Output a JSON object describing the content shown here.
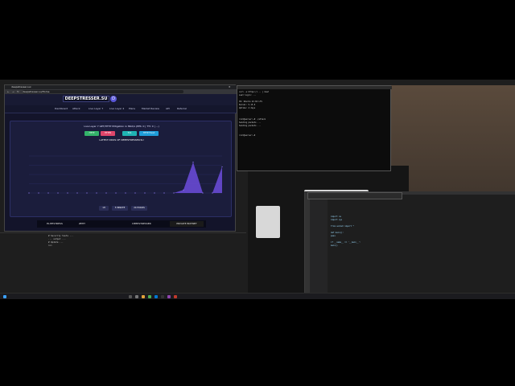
{
  "browser": {
    "tab_title": "deepstresser.sui",
    "url": "deepstresser.su/Home",
    "logo_text": "DEEPSTRESSER.SU",
    "logo_badge": "D",
    "nav": [
      "Dashboard",
      "Attack",
      "Live Layer 7",
      "Live Layer 4",
      "Plans",
      "Market Review",
      "API",
      "Referral"
    ],
    "panel_title": "Live Layer 7 GET/HTTP Mitigation in Mbit/s (PPS: 0 | TTI: 0 | ...)",
    "panel_buttons": [
      "HTTP",
      "HTTPS",
      "TLS",
      "HTTP Flood"
    ],
    "chart_heading": "LATEST DDOS OF DEEPSTRESSER.SU",
    "time_buttons": [
      "1H",
      "5 MINUTE",
      "24 HOURS"
    ],
    "partners": [
      "ELITESTRESS",
      "ZEHT",
      "",
      "DEEPSTRESSER",
      "",
      "PRIVATE BOTNET"
    ]
  },
  "chart_data": {
    "type": "area",
    "x": [
      1,
      2,
      3,
      4,
      5,
      6,
      7,
      8,
      9,
      10,
      11,
      12,
      13,
      14,
      15,
      16,
      17,
      18,
      19,
      20,
      21
    ],
    "values": [
      0,
      0,
      0,
      0,
      0,
      0,
      0,
      0,
      0,
      0,
      0,
      0,
      0,
      0,
      0,
      0,
      10,
      100,
      0,
      0,
      85
    ],
    "ylim": [
      0,
      120
    ],
    "grid": true,
    "title": "LATEST DDOS OF DEEPSTRESSER.SU",
    "color": "#6c4cdc"
  },
  "terminal": {
    "lines": [
      "curl -s https://... | bash",
      "Last login: ...",
      "OS: Ubuntu 22.04 LTS",
      "Kernel: 5.15.0",
      "Uptime: 4 days",
      "...",
      "root@server:~# ./attack",
      "Sending packets ...",
      "Sending packets ...",
      "root@server:~#"
    ]
  },
  "vscode": {
    "lines": [
      "import os",
      "import sys",
      "",
      "from socket import *",
      "",
      "def main():",
      "    pass",
      "",
      "if __name__ == '__main__':",
      "    main()"
    ]
  },
  "editor": {
    "lines": [
      "# Security tests ...",
      "",
      "... output ...",
      "# Update ...",
      "",
      ">>>"
    ]
  },
  "colors": {
    "accent": "#6c4cdc",
    "vscode_status": "#007acc"
  }
}
